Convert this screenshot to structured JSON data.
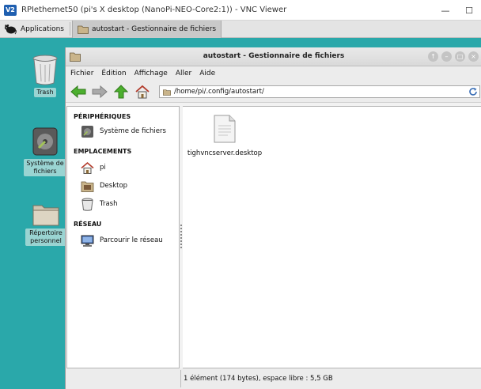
{
  "vnc": {
    "logo": "V2",
    "title": "RPIethernet50 (pi's X desktop (NanoPi-NEO-Core2:1)) - VNC Viewer",
    "minimize": "—",
    "maximize": "☐"
  },
  "taskbar": {
    "applications_label": "Applications",
    "task_label": "autostart - Gestionnaire de fichiers"
  },
  "desktop": {
    "icons": [
      {
        "label": "Trash"
      },
      {
        "label": "Système de fichiers"
      },
      {
        "label": "Répertoire personnel"
      }
    ]
  },
  "window": {
    "title": "autostart - Gestionnaire de fichiers",
    "menu": [
      "Fichier",
      "Édition",
      "Affichage",
      "Aller",
      "Aide"
    ],
    "location": "/home/pi/.config/autostart/",
    "sidebar": {
      "sections": [
        {
          "header": "PÉRIPHÉRIQUES",
          "items": [
            {
              "label": "Système de fichiers",
              "icon": "drive-icon"
            }
          ]
        },
        {
          "header": "EMPLACEMENTS",
          "items": [
            {
              "label": "pi",
              "icon": "home-icon"
            },
            {
              "label": "Desktop",
              "icon": "desktop-folder-icon"
            },
            {
              "label": "Trash",
              "icon": "trash-icon"
            }
          ]
        },
        {
          "header": "RÉSEAU",
          "items": [
            {
              "label": "Parcourir le réseau",
              "icon": "network-icon"
            }
          ]
        }
      ]
    },
    "files": [
      {
        "name": "tighvncserver.desktop",
        "icon": "document-icon"
      }
    ],
    "status": "1 élément (174 bytes), espace libre : 5,5 GB"
  },
  "colors": {
    "desktop_bg": "#2aa8aa",
    "arrow_green": "#4caf2e"
  }
}
